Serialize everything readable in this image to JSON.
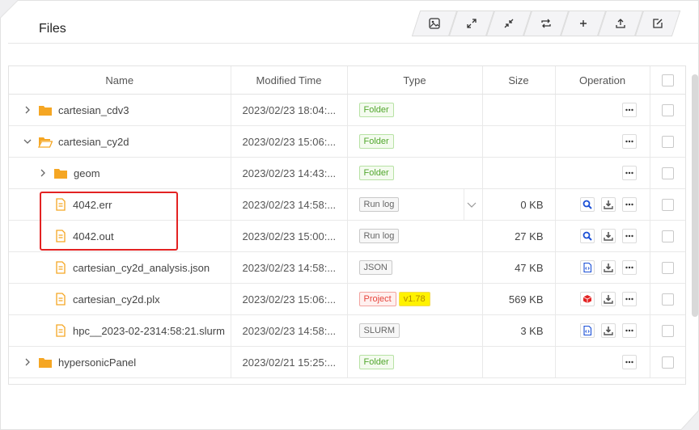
{
  "panel": {
    "title": "Files"
  },
  "toolbar": [
    {
      "icon": "image-icon"
    },
    {
      "icon": "expand-icon"
    },
    {
      "icon": "collapse-icon"
    },
    {
      "icon": "refresh-icon"
    },
    {
      "icon": "plus-icon"
    },
    {
      "icon": "upload-icon"
    },
    {
      "icon": "edit-icon"
    }
  ],
  "columns": {
    "name": "Name",
    "modified": "Modified Time",
    "type": "Type",
    "size": "Size",
    "operation": "Operation"
  },
  "rows": [
    {
      "name": "cartesian_cdv3",
      "time": "2023/02/23 18:04:...",
      "type": "Folder",
      "size": "",
      "kind": "folder",
      "expand": "collapsed"
    },
    {
      "name": "cartesian_cy2d",
      "time": "2023/02/23 15:06:...",
      "type": "Folder",
      "size": "",
      "kind": "folder",
      "expand": "expanded"
    },
    {
      "name": "geom",
      "time": "2023/02/23 14:43:...",
      "type": "Folder",
      "size": "",
      "kind": "folder",
      "expand": "collapsed"
    },
    {
      "name": "4042.err",
      "time": "2023/02/23 14:58:...",
      "type": "Run log",
      "size": "0 KB",
      "kind": "log",
      "has_dropdown": true
    },
    {
      "name": "4042.out",
      "time": "2023/02/23 15:00:...",
      "type": "Run log",
      "size": "27 KB",
      "kind": "log"
    },
    {
      "name": "cartesian_cy2d_analysis.json",
      "time": "2023/02/23 14:58:...",
      "type": "JSON",
      "size": "47 KB",
      "kind": "json"
    },
    {
      "name": "cartesian_cy2d.plx",
      "time": "2023/02/23 15:06:...",
      "type": "Project",
      "version": "v1.78",
      "size": "569 KB",
      "kind": "project"
    },
    {
      "name": "hpc__2023-02-2314:58:21.slurm",
      "time": "2023/02/23 14:58:...",
      "type": "SLURM",
      "size": "3 KB",
      "kind": "slurm"
    },
    {
      "name": "hypersonicPanel",
      "time": "2023/02/21 15:25:...",
      "type": "Folder",
      "size": "",
      "kind": "folder",
      "expand": "collapsed"
    }
  ],
  "colors": {
    "folder": "#f5a623",
    "file": "#f5a623",
    "search": "#1a4fd6",
    "highlight": "#e32222"
  }
}
